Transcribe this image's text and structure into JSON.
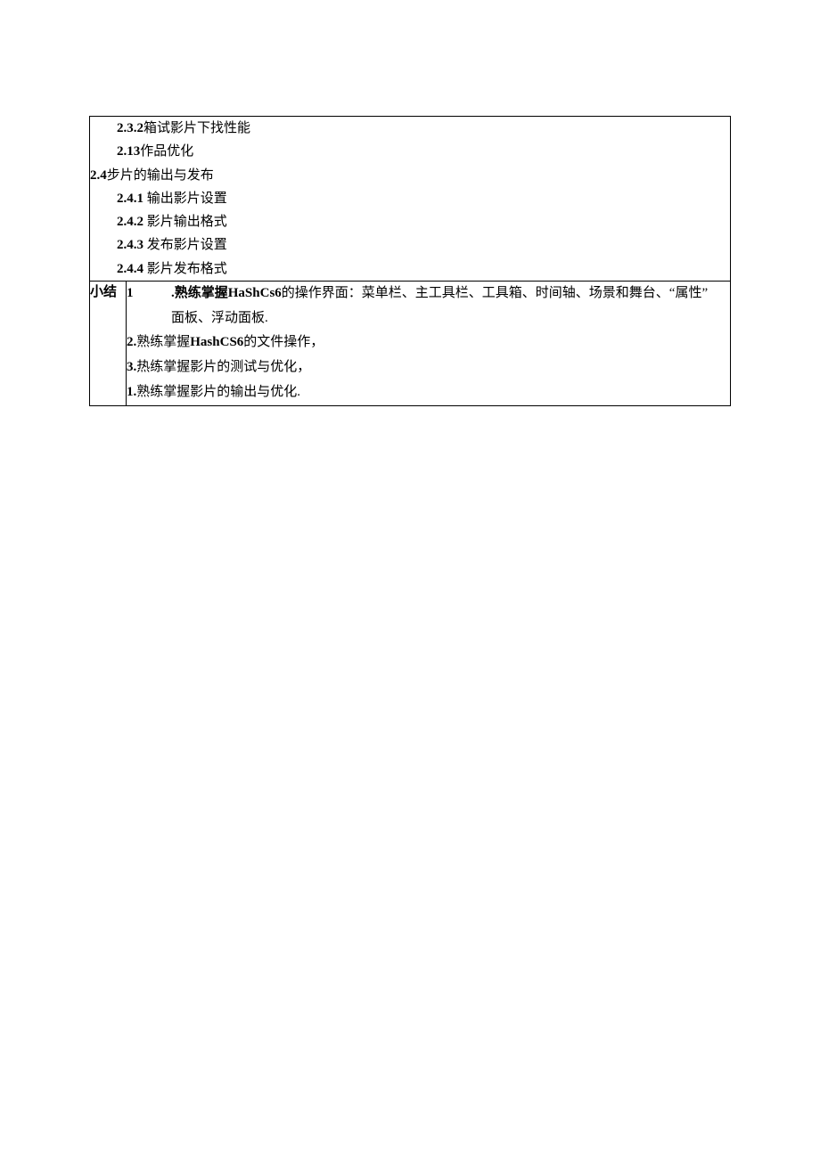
{
  "top": {
    "l1_num": "2.3.2",
    "l1_text": "箱试影片下找性能",
    "l2_num": "2.13",
    "l2_text": "作品优化",
    "l3_num": "2.4",
    "l3_text": "步片的输出与发布",
    "l4_num": "2.4.1",
    "l4_text": "输出影片设置",
    "l5_num": "2.4.2",
    "l5_text": "影片输出格式",
    "l6_num": "2.4.3",
    "l6_text": "发布影片设置",
    "l7_num": "2.4.4",
    "l7_text": "影片发布格式"
  },
  "summary": {
    "label": "小结",
    "s1_num": "1",
    "s1_lead": ".熟练掌握",
    "s1_bold": "HaShCs6",
    "s1_tail": "的操作界面：菜单栏、主工具栏、工具箱、时间轴、场景和舞台、“属性”",
    "s1_line2": "面板、浮动面板.",
    "s2_num": "2.",
    "s2_lead": "熟练掌握",
    "s2_bold": "HashCS6",
    "s2_tail": "的文件操作，",
    "s3_num": "3.",
    "s3_text": "热练掌握影片的测试与优化，",
    "s4_num": "1.",
    "s4_text": "熟练掌握影片的输出与优化."
  }
}
